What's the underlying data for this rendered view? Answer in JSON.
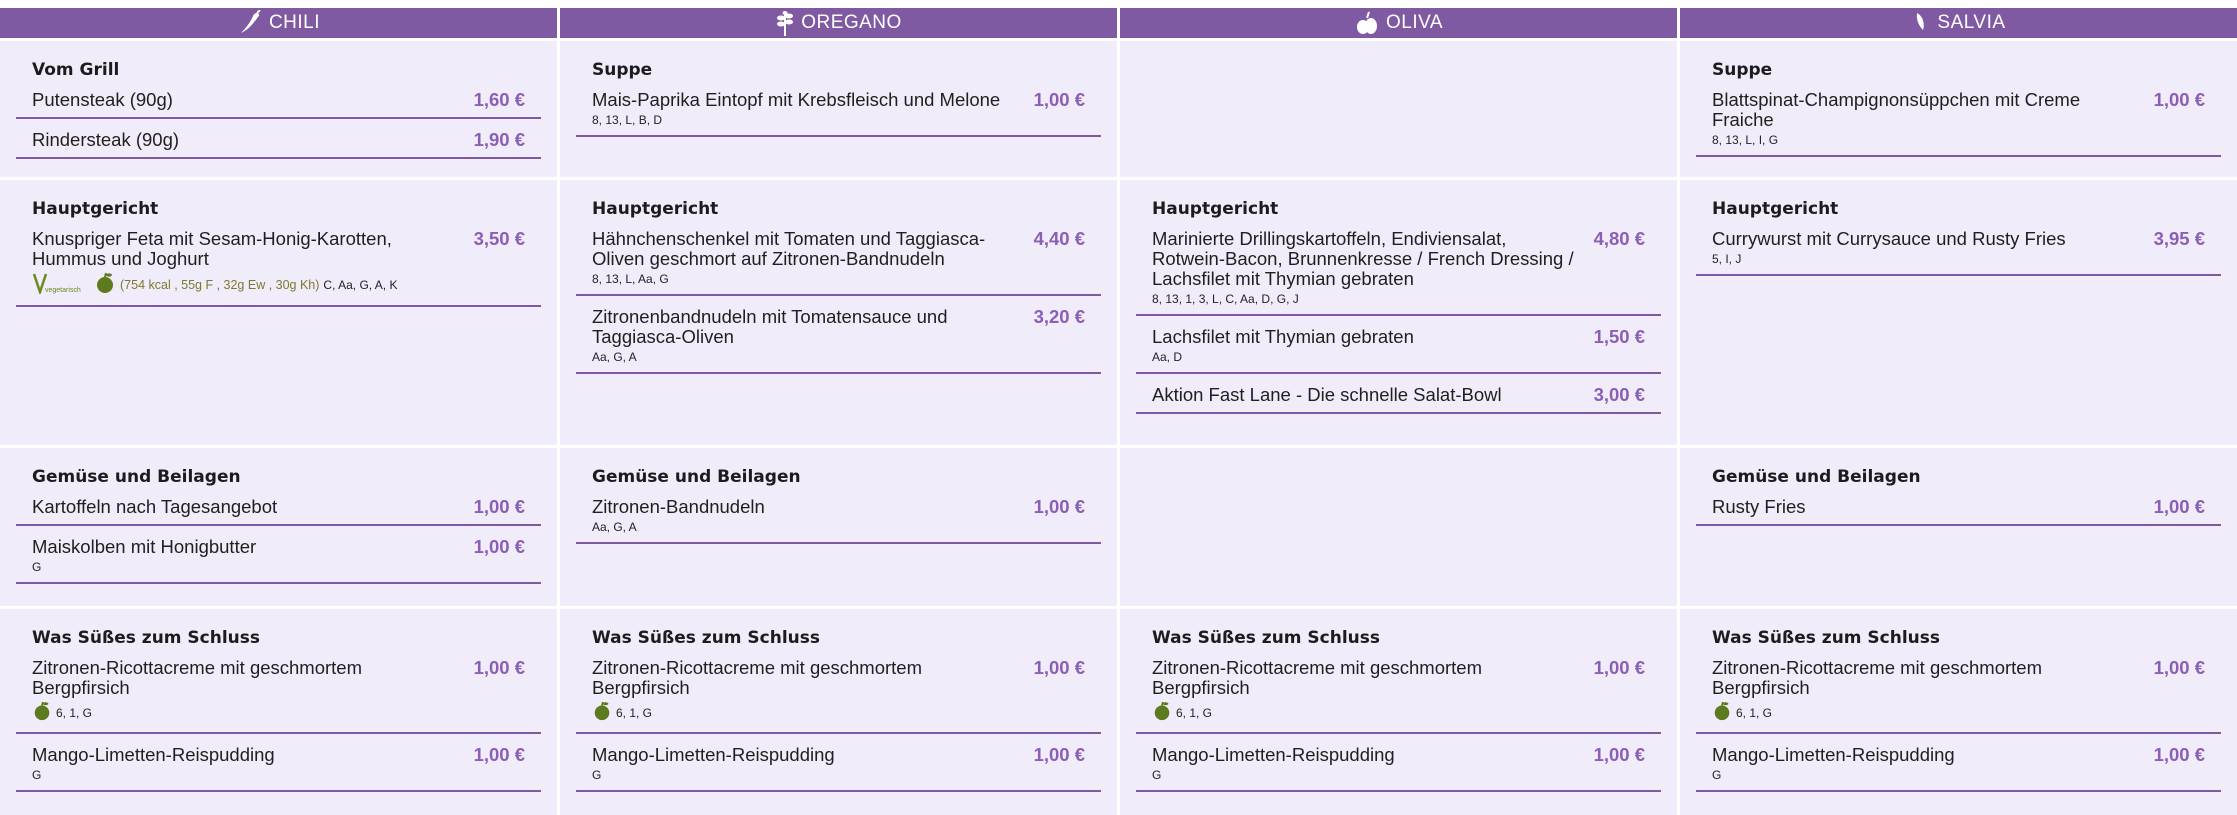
{
  "columns": [
    {
      "name": "CHILI",
      "icon": "chili-pepper-icon",
      "sections": {
        "grill": {
          "title": "Vom Grill",
          "items": [
            {
              "name": "Putensteak (90g)",
              "price": "1,60 €",
              "allergens": ""
            },
            {
              "name": "Rindersteak (90g)",
              "price": "1,90 €",
              "allergens": ""
            }
          ]
        },
        "main": {
          "title": "Hauptgericht",
          "items": [
            {
              "name": "Knuspriger Feta mit Sesam-Honig-Karotten, Hummus und Joghurt",
              "price": "3,50 €",
              "label": "vegetarisch",
              "nutrition": "(754 kcal , 55g F , 32g Ew , 30g Kh)",
              "allergens": "C, Aa, G, A, K"
            }
          ]
        },
        "sides": {
          "title": "Gemüse und Beilagen",
          "items": [
            {
              "name": "Kartoffeln nach Tagesangebot",
              "price": "1,00 €",
              "allergens": ""
            },
            {
              "name": "Maiskolben mit Honigbutter",
              "price": "1,00 €",
              "allergens": "G"
            }
          ]
        },
        "dessert": {
          "title": "Was Süßes zum Schluss",
          "items": [
            {
              "name": "Zitronen-Ricottacreme mit geschmortem Bergpfirsich",
              "price": "1,00 €",
              "allergens": "6, 1, G"
            },
            {
              "name": "Mango-Limetten-Reispudding",
              "price": "1,00 €",
              "allergens": "G"
            }
          ]
        }
      }
    },
    {
      "name": "OREGANO",
      "icon": "oregano-herb-icon",
      "sections": {
        "soup": {
          "title": "Suppe",
          "items": [
            {
              "name": "Mais-Paprika Eintopf mit Krebsfleisch und Melone",
              "price": "1,00 €",
              "allergens": "8, 13, L, B, D"
            }
          ]
        },
        "main": {
          "title": "Hauptgericht",
          "items": [
            {
              "name": "Hähnchenschenkel mit Tomaten und Taggiasca-Oliven geschmort auf Zitronen-Bandnudeln",
              "price": "4,40 €",
              "allergens": "8, 13, L, Aa, G"
            },
            {
              "name": "Zitronenbandnudeln mit Tomatensauce und Taggiasca-Oliven",
              "price": "3,20 €",
              "allergens": "Aa, G, A"
            }
          ]
        },
        "sides": {
          "title": "Gemüse und Beilagen",
          "items": [
            {
              "name": "Zitronen-Bandnudeln",
              "price": "1,00 €",
              "allergens": "Aa, G, A"
            }
          ]
        },
        "dessert": {
          "title": "Was Süßes zum Schluss",
          "items": [
            {
              "name": "Zitronen-Ricottacreme mit geschmortem Bergpfirsich",
              "price": "1,00 €",
              "allergens": "6, 1, G"
            },
            {
              "name": "Mango-Limetten-Reispudding",
              "price": "1,00 €",
              "allergens": "G"
            }
          ]
        }
      }
    },
    {
      "name": "OLIVA",
      "icon": "olive-icon",
      "sections": {
        "main": {
          "title": "Hauptgericht",
          "items": [
            {
              "name": "Marinierte Drillingskartoffeln, Endiviensalat, Rotwein-Bacon, Brunnenkresse / French Dressing / Lachsfilet mit Thymian gebraten",
              "price": "4,80 €",
              "allergens": "8, 13, 1, 3, L, C, Aa, D, G, J"
            },
            {
              "name": "Lachsfilet mit Thymian gebraten",
              "price": "1,50 €",
              "allergens": "Aa, D"
            },
            {
              "name": "Aktion Fast Lane - Die schnelle Salat-Bowl",
              "price": "3,00 €",
              "allergens": ""
            }
          ]
        },
        "dessert": {
          "title": "Was Süßes zum Schluss",
          "items": [
            {
              "name": "Zitronen-Ricottacreme mit geschmortem Bergpfirsich",
              "price": "1,00 €",
              "allergens": "6, 1, G"
            },
            {
              "name": "Mango-Limetten-Reispudding",
              "price": "1,00 €",
              "allergens": "G"
            }
          ]
        }
      }
    },
    {
      "name": "SALVIA",
      "icon": "sage-leaf-icon",
      "sections": {
        "soup": {
          "title": "Suppe",
          "items": [
            {
              "name": "Blattspinat-Champignonsüppchen mit Creme Fraiche",
              "price": "1,00 €",
              "allergens": "8, 13, L, I, G"
            }
          ]
        },
        "main": {
          "title": "Hauptgericht",
          "items": [
            {
              "name": "Currywurst mit Currysauce und Rusty Fries",
              "price": "3,95 €",
              "allergens": "5, I, J"
            }
          ]
        },
        "sides": {
          "title": "Gemüse und Beilagen",
          "items": [
            {
              "name": "Rusty Fries",
              "price": "1,00 €",
              "allergens": ""
            }
          ]
        },
        "dessert": {
          "title": "Was Süßes zum Schluss",
          "items": [
            {
              "name": "Zitronen-Ricottacreme mit geschmortem Bergpfirsich",
              "price": "1,00 €",
              "allergens": "6, 1, G"
            },
            {
              "name": "Mango-Limetten-Reispudding",
              "price": "1,00 €",
              "allergens": "G"
            }
          ]
        }
      }
    }
  ],
  "colors": {
    "header": "#7f5aa2",
    "cell_bg": "#f1ecf9",
    "price": "#8a5fb5",
    "divider": "#7f5aa2",
    "nutrition": "#7d7a2c",
    "leaf": "#5e7a1e"
  }
}
